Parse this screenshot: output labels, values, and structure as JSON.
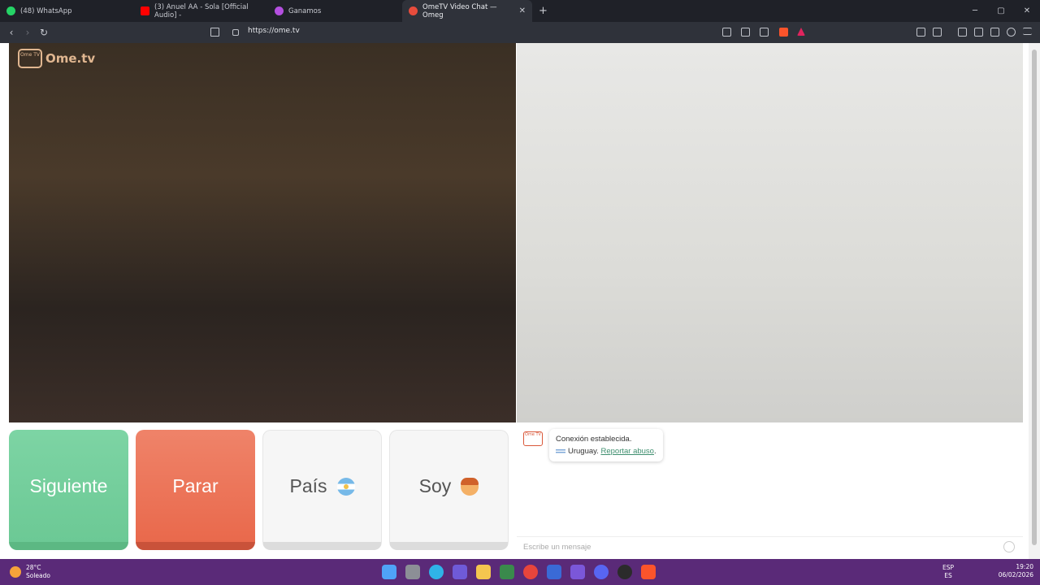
{
  "tabs": [
    {
      "title": "(48) WhatsApp",
      "color": "#25d366"
    },
    {
      "title": "(3) Anuel AA - Sola [Official Audio] -",
      "color": "#ff0000"
    },
    {
      "title": "Ganamos",
      "color": "#b44fe0"
    },
    {
      "title": "OmeTV Video Chat — Omeg",
      "color": "#e74c3c",
      "active": true
    }
  ],
  "address": {
    "url": "https://ome.tv"
  },
  "logo": {
    "badge": "Ome TV",
    "text": "Ome.tv"
  },
  "buttons": {
    "next": "Siguiente",
    "stop": "Parar",
    "country": "País",
    "gender": "Soy"
  },
  "chat": {
    "logo": "Ome TV",
    "line1": "Conexión establecida.",
    "country": "Uruguay.",
    "report": "Reportar abuso",
    "report_end": ".",
    "placeholder": "Escribe un mensaje"
  },
  "taskbar": {
    "temp": "28°C",
    "condition": "Soleado",
    "lang_top": "ESP",
    "lang_bottom": "ES",
    "time": "19:20",
    "date": "06/02/2026"
  },
  "colors": {
    "next_button": "#6cc995",
    "stop_button": "#e9694c",
    "taskbar": "#5a2a78",
    "report_link": "#3f8f6f"
  }
}
